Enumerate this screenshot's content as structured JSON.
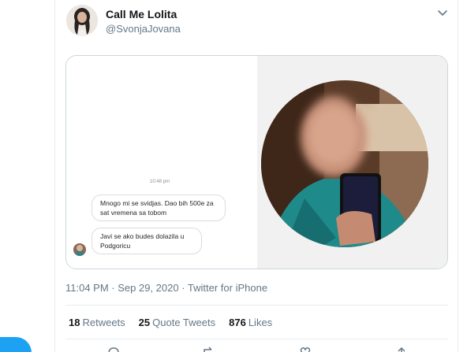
{
  "tweet": {
    "author": {
      "display_name": "Call Me Lolita",
      "handle": "@SvonjaJovana"
    },
    "media": {
      "chat": {
        "time": "10:48 pm",
        "messages": [
          "Mnogo mi se svidjas. Dao bih 500e za sat vremena sa tobom",
          "Javi se ako budes dolazila u Podgoricu"
        ]
      }
    },
    "timestamp": "11:04 PM · Sep 29, 2020 · Twitter for iPhone",
    "stats": {
      "retweets_count": "18",
      "retweets_label": "Retweets",
      "quotes_count": "25",
      "quotes_label": "Quote Tweets",
      "likes_count": "876",
      "likes_label": "Likes"
    },
    "actions": [
      "reply-icon",
      "retweet-icon",
      "like-icon",
      "share-icon"
    ]
  },
  "colors": {
    "accent": "#1da1f2",
    "secondary_text": "#657786",
    "border": "#e6ecf0"
  }
}
